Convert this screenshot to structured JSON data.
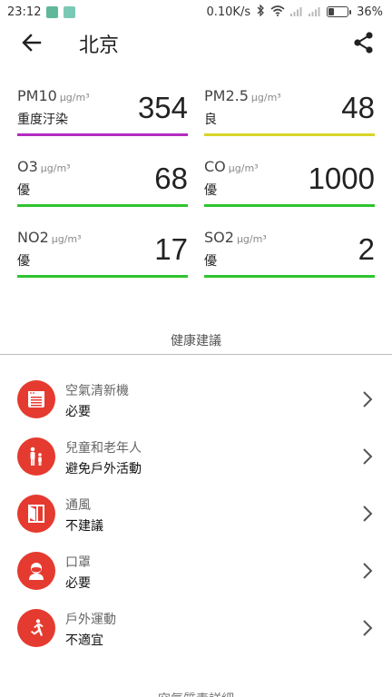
{
  "status_bar": {
    "time": "23:12",
    "net_speed": "0.10K/s",
    "battery_percent": "36%",
    "battery_level": 0.36
  },
  "header": {
    "title": "北京",
    "back_icon": "arrow-left-icon",
    "share_icon": "share-icon"
  },
  "pollutants": [
    {
      "name": "PM10",
      "unit": "μg/m³",
      "value": "354",
      "level": "重度汙染",
      "color": "#b32cc0"
    },
    {
      "name": "PM2.5",
      "unit": "μg/m³",
      "value": "48",
      "level": "良",
      "color": "#d9d42a"
    },
    {
      "name": "O3",
      "unit": "μg/m³",
      "value": "68",
      "level": "優",
      "color": "#2fc42f"
    },
    {
      "name": "CO",
      "unit": "μg/m³",
      "value": "1000",
      "level": "優",
      "color": "#2fc42f"
    },
    {
      "name": "NO2",
      "unit": "μg/m³",
      "value": "17",
      "level": "優",
      "color": "#2fc42f"
    },
    {
      "name": "SO2",
      "unit": "μg/m³",
      "value": "2",
      "level": "優",
      "color": "#2fc42f"
    }
  ],
  "health": {
    "header": "健康建議",
    "accent": "#e53a2f",
    "items": [
      {
        "label": "空氣清新機",
        "status": "必要",
        "icon": "air-purifier-icon"
      },
      {
        "label": "兒童和老年人",
        "status": "避免戶外活動",
        "icon": "family-icon"
      },
      {
        "label": "通風",
        "status": "不建議",
        "icon": "window-icon"
      },
      {
        "label": "口罩",
        "status": "必要",
        "icon": "mask-icon"
      },
      {
        "label": "戶外運動",
        "status": "不適宜",
        "icon": "running-icon"
      }
    ]
  },
  "footer": {
    "text": "空氣質素詳細"
  }
}
